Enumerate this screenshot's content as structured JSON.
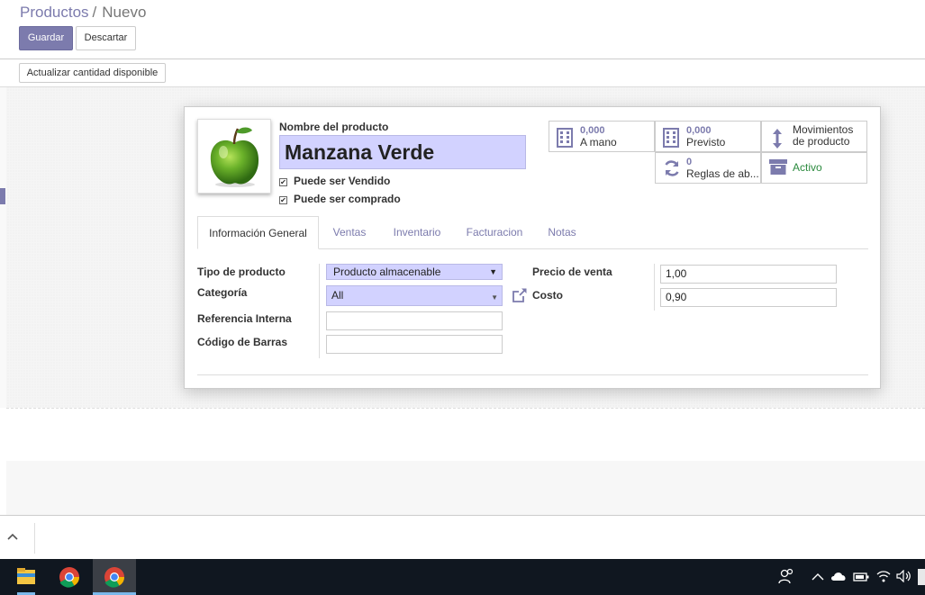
{
  "breadcrumb": {
    "parent": "Productos",
    "separator": "/",
    "current": "Nuevo"
  },
  "toolbar": {
    "save_label": "Guardar",
    "discard_label": "Descartar"
  },
  "statusbar": {
    "update_qty_label": "Actualizar cantidad disponible"
  },
  "product": {
    "name_label": "Nombre del producto",
    "name_value": "Manzana Verde",
    "can_be_sold_label": "Puede ser Vendido",
    "can_be_sold_checked": true,
    "can_be_purchased_label": "Puede ser comprado",
    "can_be_purchased_checked": true,
    "image_icon": "green-apple-image"
  },
  "stats": [
    {
      "icon": "building-icon",
      "value": "0,000",
      "label": "A mano"
    },
    {
      "icon": "building-icon",
      "value": "0,000",
      "label": "Previsto"
    },
    {
      "icon": "arrows-vertical-icon",
      "value": "",
      "label": "Movimientos de producto"
    },
    {
      "icon": "refresh-icon",
      "value": "0",
      "label": "Reglas de ab..."
    },
    {
      "icon": "archive-icon",
      "value": "",
      "label": "Activo"
    }
  ],
  "tabs": [
    "Información General",
    "Ventas",
    "Inventario",
    "Facturacion",
    "Notas"
  ],
  "general": {
    "type_label": "Tipo de producto",
    "type_value": "Producto almacenable",
    "category_label": "Categoría",
    "category_value": "All",
    "internal_ref_label": "Referencia Interna",
    "internal_ref_value": "",
    "barcode_label": "Código de Barras",
    "barcode_value": "",
    "sale_price_label": "Precio de venta",
    "sale_price_value": "1,00",
    "cost_label": "Costo",
    "cost_value": "0,90"
  },
  "colors": {
    "primary": "#7c7bad",
    "required_bg": "#d2d2ff",
    "active_green": "#2b8a3e"
  }
}
